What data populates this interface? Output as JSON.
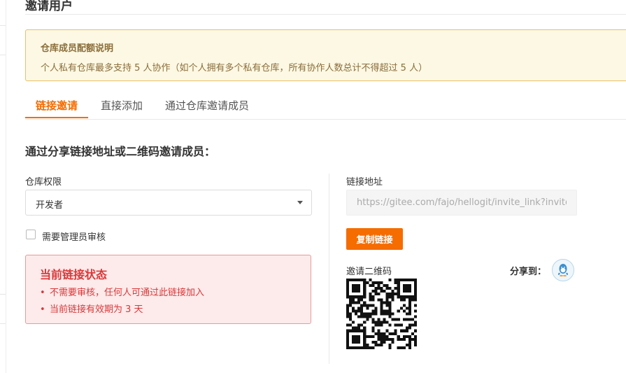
{
  "page": {
    "title": "邀请用户"
  },
  "notice": {
    "title": "仓库成员配额说明",
    "body": "个人私有仓库最多支持 5 人协作（如个人拥有多个私有仓库，所有协作人数总计不得超过 5 人）"
  },
  "tabs": [
    {
      "label": "链接邀请",
      "active": true
    },
    {
      "label": "直接添加",
      "active": false
    },
    {
      "label": "通过仓库邀请成员",
      "active": false
    }
  ],
  "section": {
    "heading": "通过分享链接地址或二维码邀请成员："
  },
  "permission": {
    "label": "仓库权限",
    "selected": "开发者"
  },
  "approval": {
    "label": "需要管理员审核",
    "checked": false
  },
  "status": {
    "title": "当前链接状态",
    "items": [
      "不需要审核，任何人可通过此链接加入",
      "当前链接有效期为 3 天"
    ]
  },
  "link": {
    "label": "链接地址",
    "value": "https://gitee.com/fajo/hellogit/invite_link?invite=",
    "copy_label": "复制链接"
  },
  "qr": {
    "label": "邀请二维码"
  },
  "share": {
    "label": "分享到：",
    "icon": "qq-icon"
  },
  "colors": {
    "accent": "#f56c00",
    "notice_bg": "#fcf8e3",
    "notice_text": "#8a6d3b",
    "danger": "#d9383a",
    "danger_bg": "#fdeaea"
  }
}
